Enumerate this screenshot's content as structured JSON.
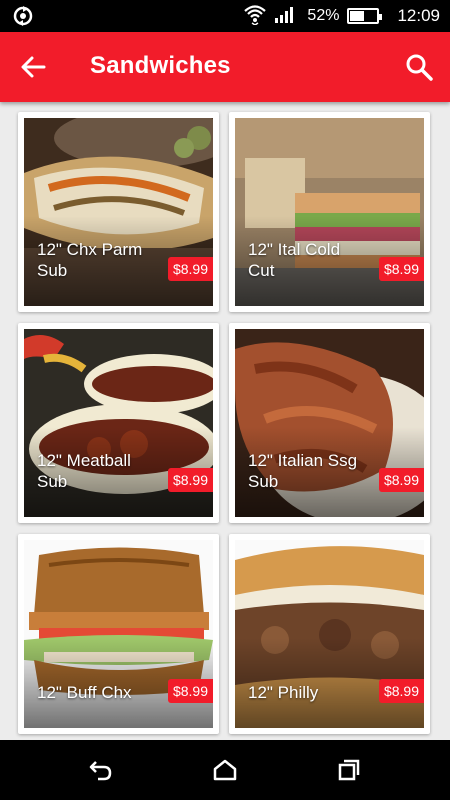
{
  "status_bar": {
    "battery_percent": "52%",
    "battery_level": 0.52,
    "time": "12:09"
  },
  "app_bar": {
    "title": "Sandwiches"
  },
  "items": [
    {
      "name": "12\" Chx Parm Sub",
      "price": "$8.99"
    },
    {
      "name": "12\" Ital Cold Cut",
      "price": "$8.99"
    },
    {
      "name": "12\" Meatball Sub",
      "price": "$8.99"
    },
    {
      "name": "12\" Italian Ssg Sub",
      "price": "$8.99"
    },
    {
      "name": "12\" Buff Chx",
      "price": "$8.99"
    },
    {
      "name": "12\" Philly",
      "price": "$8.99"
    }
  ],
  "colors": {
    "accent": "#f21c2a",
    "status_bar": "#000000",
    "background": "#ececec"
  }
}
